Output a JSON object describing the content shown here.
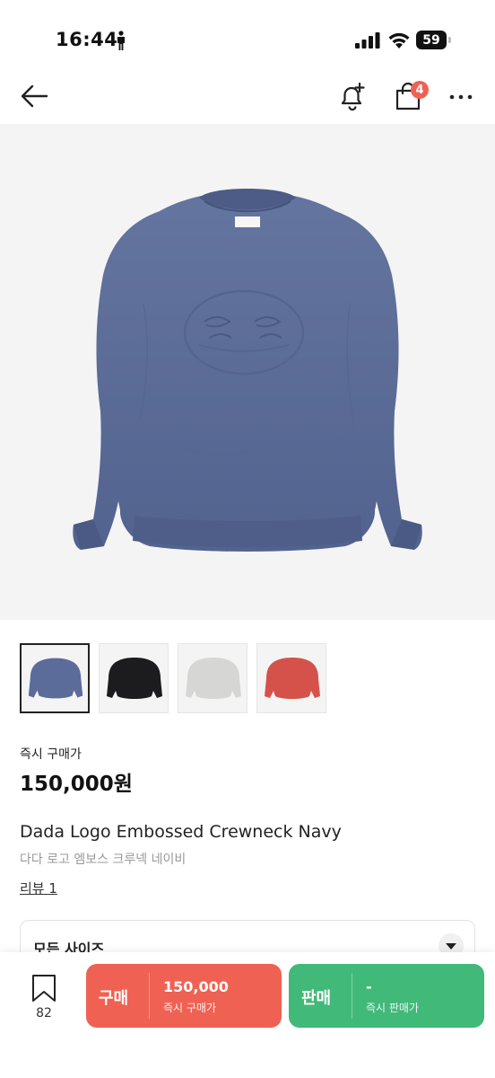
{
  "status_bar": {
    "time": "16:44",
    "battery": "59"
  },
  "nav": {
    "cart_badge": "4"
  },
  "gallery": {
    "thumbnails": [
      {
        "color": "#5b6c9a"
      },
      {
        "color": "#1c1c1e"
      },
      {
        "color": "#d6d6d4"
      },
      {
        "color": "#d5524a"
      }
    ],
    "hero_color": "#5b6c9a"
  },
  "product": {
    "price_label": "즉시 구매가",
    "price": "150,000원",
    "title_en": "Dada Logo Embossed Crewneck Navy",
    "title_ko": "다다 로고 엠보스 크루넥 네이비",
    "review": "리뷰 1"
  },
  "size_select": {
    "label": "모든 사이즈"
  },
  "bottom_bar": {
    "wish_count": "82",
    "buy": {
      "label": "구매",
      "price": "150,000",
      "sub": "즉시 구매가",
      "color": "#ef6253"
    },
    "sell": {
      "label": "판매",
      "price": "-",
      "sub": "즉시 판매가",
      "color": "#41b979"
    }
  }
}
